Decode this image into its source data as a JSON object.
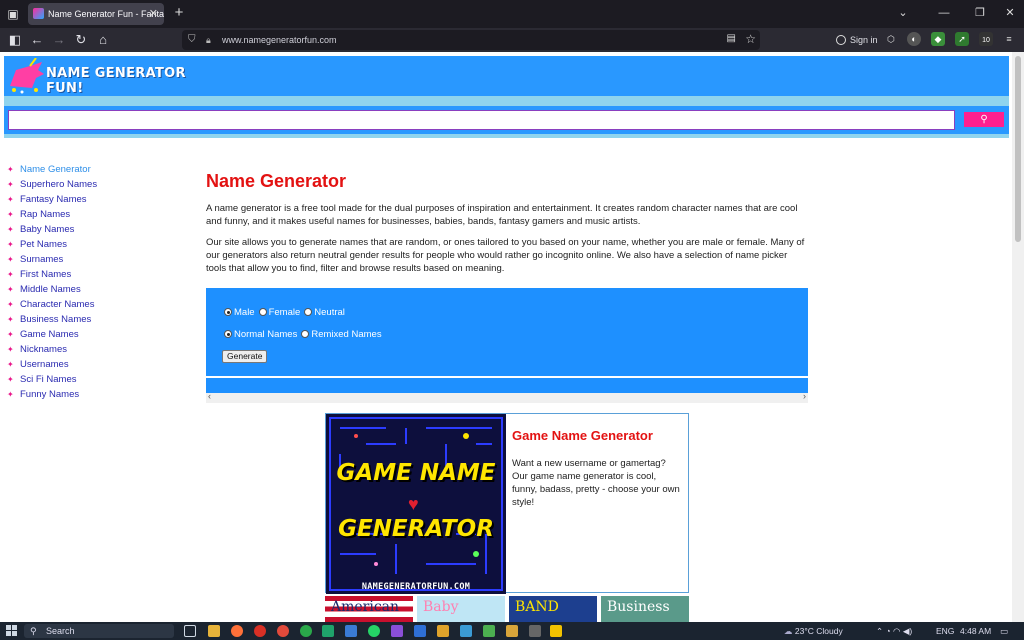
{
  "browser": {
    "tab_title": "Name Generator Fun - Fantasy",
    "url": "www.namegeneratorfun.com",
    "signin_label": "Sign in",
    "badge_count": "10"
  },
  "site": {
    "logo_text": "NAME GENERATOR FUN!",
    "search": {
      "value": "",
      "placeholder": ""
    }
  },
  "sidebar": {
    "items": [
      "Name Generator",
      "Superhero Names",
      "Fantasy Names",
      "Rap Names",
      "Baby Names",
      "Pet Names",
      "Surnames",
      "First Names",
      "Middle Names",
      "Character Names",
      "Business Names",
      "Game Names",
      "Nicknames",
      "Usernames",
      "Sci Fi Names",
      "Funny Names"
    ]
  },
  "main": {
    "title": "Name Generator",
    "paragraphs": [
      "A name generator is a free tool made for the dual purposes of inspiration and entertainment. It creates random character names that are cool and funny, and it makes useful names for businesses, babies, bands, fantasy gamers and music artists.",
      "Our site allows you to generate names that are random, or ones tailored to you based on your name, whether you are male or female. Many of our generators also return neutral gender results for people who would rather go incognito online. We also have a selection of name picker tools that allow you to find, filter and browse results based on meaning."
    ]
  },
  "generator": {
    "gender_options": [
      "Male",
      "Female",
      "Neutral"
    ],
    "gender_selected": "Male",
    "type_options": [
      "Normal Names",
      "Remixed Names"
    ],
    "type_selected": "Normal Names",
    "generate_label": "Generate"
  },
  "featured": {
    "image_line1": "GAME NAME",
    "image_line2": "GENERATOR",
    "image_url": "NAMEGENERATORFUN.COM",
    "title": "Game Name Generator",
    "description": "Want a new username or gamertag? Our game name generator is cool, funny, badass, pretty - choose your own style!"
  },
  "thumbnails": [
    "American",
    "Baby",
    "BAND",
    "Business"
  ],
  "taskbar": {
    "search_label": "Search",
    "weather": "23°C  Cloudy",
    "language": "ENG",
    "time": "4:48 AM"
  },
  "colors": {
    "header_blue": "#2998ff",
    "panel_blue": "#1e90ff",
    "title_red": "#e31212",
    "accent_pink": "#ff1f8f",
    "link_blue": "#2a2ab0"
  }
}
